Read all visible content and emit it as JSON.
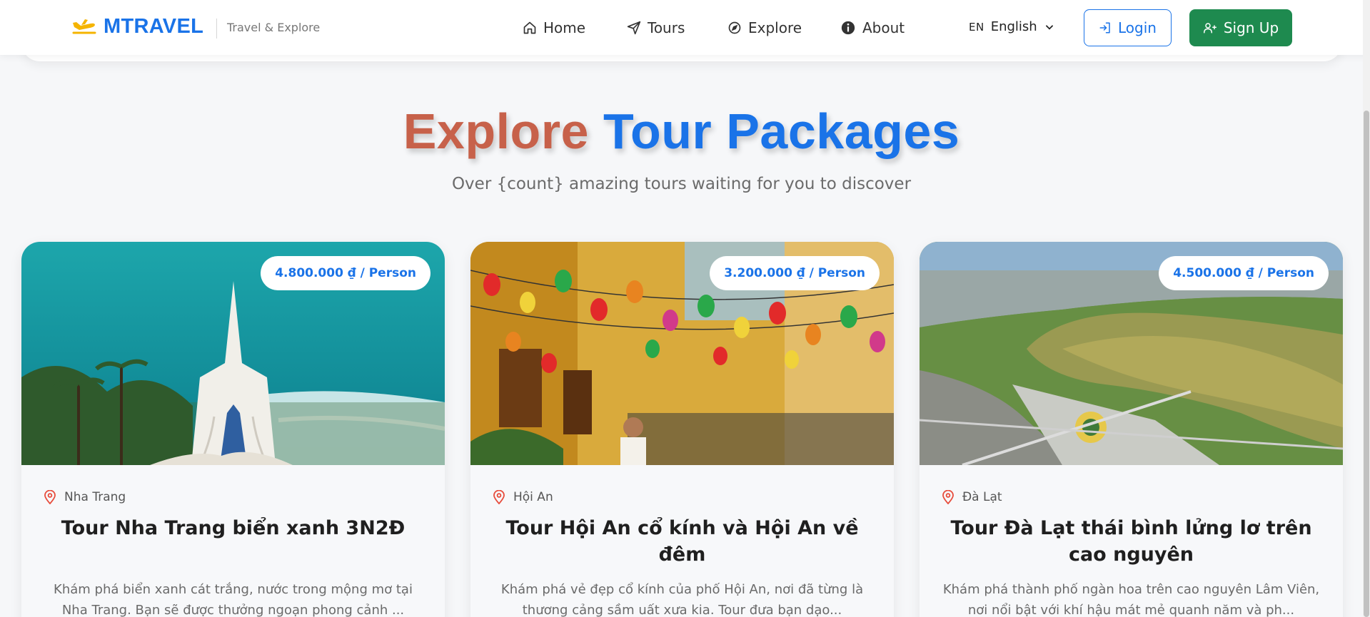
{
  "header": {
    "brand_name": "MTRAVEL",
    "tagline": "Travel & Explore",
    "nav": [
      {
        "label": "Home",
        "icon": "home-icon"
      },
      {
        "label": "Tours",
        "icon": "send-icon"
      },
      {
        "label": "Explore",
        "icon": "compass-icon"
      },
      {
        "label": "About",
        "icon": "info-icon"
      }
    ],
    "language": {
      "code": "EN",
      "label": "English"
    },
    "login_label": "Login",
    "signup_label": "Sign Up"
  },
  "hero": {
    "title_part1": "Explore",
    "title_part2": "Tour Packages",
    "subtitle": "Over {count} amazing tours waiting for you to discover"
  },
  "tours": [
    {
      "price": "4.800.000 ₫ / Person",
      "location": "Nha Trang",
      "title": "Tour Nha Trang biển xanh 3N2Đ",
      "description": "Khám phá biển xanh cát trắng, nước trong mộng mơ tại Nha Trang. Bạn sẽ được thưởng ngoạn phong cảnh ..."
    },
    {
      "price": "3.200.000 ₫ / Person",
      "location": "Hội An",
      "title": "Tour Hội An cổ kính và Hội An về đêm",
      "description": "Khám phá vẻ đẹp cổ kính của phố Hội An, nơi đã từng là thương cảng sầm uất xưa kia. Tour đưa bạn dạo..."
    },
    {
      "price": "4.500.000 ₫ / Person",
      "location": "Đà Lạt",
      "title": "Tour Đà Lạt thái bình lửng lơ trên cao nguyên",
      "description": "Khám phá thành phố ngàn hoa trên cao nguyên Lâm Viên, nơi nổi bật với khí hậu mát mẻ quanh năm và ph..."
    }
  ],
  "colors": {
    "primary": "#1a73e8",
    "signup": "#1e8a4f",
    "logo_accent": "#f5b400",
    "location_pin": "#e74c3c",
    "background": "#f6f7f9"
  }
}
